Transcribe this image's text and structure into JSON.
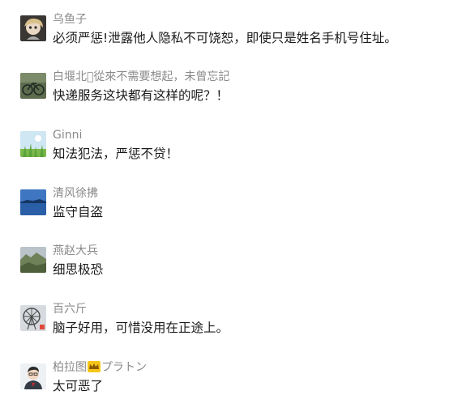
{
  "comments": [
    {
      "nickname": "乌鱼子",
      "content": "必须严惩!泄露他人隐私不可饶恕，即使只是姓名手机号住址。",
      "avatar": "doll-avatar"
    },
    {
      "nickname": "白堰北\u0000從來不需要想起，未曾忘記",
      "content": "快递服务这块都有这样的呢？！",
      "avatar": "bicycle-avatar"
    },
    {
      "nickname": "Ginni",
      "content": "知法犯法，严惩不贷！",
      "avatar": "grass-avatar"
    },
    {
      "nickname": "清风徐拂",
      "content": "监守自盗",
      "avatar": "lake-avatar"
    },
    {
      "nickname": "燕赵大兵",
      "content": "细思极恐",
      "avatar": "mountain-avatar"
    },
    {
      "nickname": "百六斤",
      "content": "脑子好用，可惜没用在正途上。",
      "avatar": "ferris-wheel-avatar"
    },
    {
      "nickname": "柏拉图",
      "nickname_suffix": "プラトン",
      "content": "太可恶了",
      "avatar": "cartoon-man-avatar",
      "badge": "crown-icon"
    }
  ]
}
